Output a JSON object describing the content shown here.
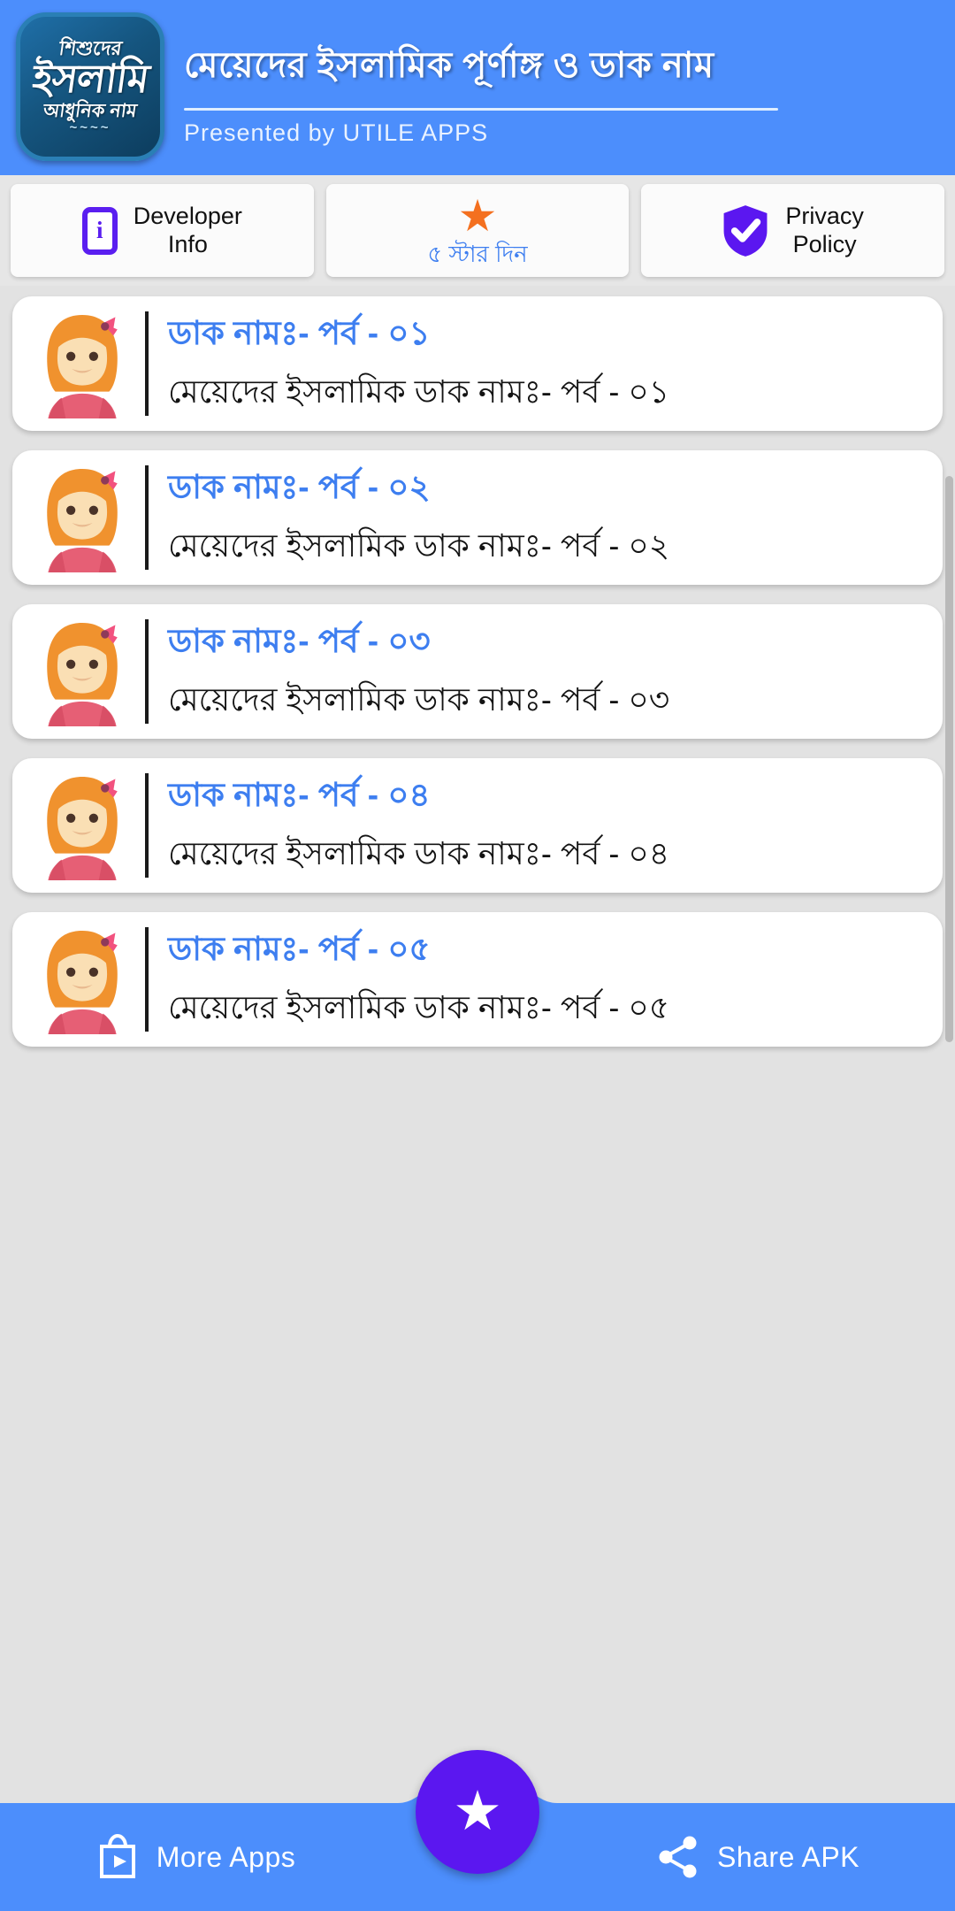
{
  "header": {
    "logo": {
      "line1": "শিশুদের",
      "line2": "ইসলামি",
      "line3": "আধুনিক নাম",
      "line4": "~~~~",
      "icon_name": "app-logo"
    },
    "title": "মেয়েদের ইসলামিক পূর্ণাঙ্গ ও ডাক নাম",
    "subtitle": "Presented by UTILE APPS",
    "bg_color": "#4c8efc"
  },
  "topbar": {
    "buttons": [
      {
        "label": "Developer\nInfo",
        "label_line1": "Developer",
        "label_line2": "Info",
        "icon": "info-icon",
        "icon_color": "#5a1ef0",
        "style": "inline"
      },
      {
        "label": "৫ স্টার দিন",
        "icon": "star-icon",
        "icon_color": "#f4701f",
        "style": "stacked"
      },
      {
        "label": "Privacy\nPolicy",
        "label_line1": "Privacy",
        "label_line2": "Policy",
        "icon": "shield-check-icon",
        "icon_color": "#5b17f0",
        "style": "inline"
      }
    ]
  },
  "list": {
    "items": [
      {
        "title": "ডাক নামঃ- পর্ব - ০১",
        "subtitle": "মেয়েদের ইসলামিক ডাক নামঃ- পর্ব - ০১",
        "icon": "girl-avatar-icon"
      },
      {
        "title": "ডাক নামঃ- পর্ব - ০২",
        "subtitle": "মেয়েদের ইসলামিক ডাক নামঃ- পর্ব - ০২",
        "icon": "girl-avatar-icon"
      },
      {
        "title": "ডাক নামঃ- পর্ব - ০৩",
        "subtitle": "মেয়েদের ইসলামিক ডাক নামঃ- পর্ব - ০৩",
        "icon": "girl-avatar-icon"
      },
      {
        "title": "ডাক নামঃ- পর্ব - ০৪",
        "subtitle": "মেয়েদের ইসলামিক ডাক নামঃ- পর্ব - ০৪",
        "icon": "girl-avatar-icon"
      },
      {
        "title": "ডাক নামঃ- পর্ব - ০৫",
        "subtitle": "মেয়েদের ইসলামিক ডাক নামঃ- পর্ব - ০৫",
        "icon": "girl-avatar-icon"
      }
    ],
    "title_color": "#3d7ef0",
    "subtitle_color": "#131313"
  },
  "bottomnav": {
    "left": {
      "label": "More Apps",
      "icon": "play-store-bag-icon"
    },
    "right": {
      "label": "Share APK",
      "icon": "share-icon"
    },
    "fab": {
      "icon": "star-icon",
      "color": "#5b17f0"
    },
    "bg_color": "#4c8efc"
  }
}
